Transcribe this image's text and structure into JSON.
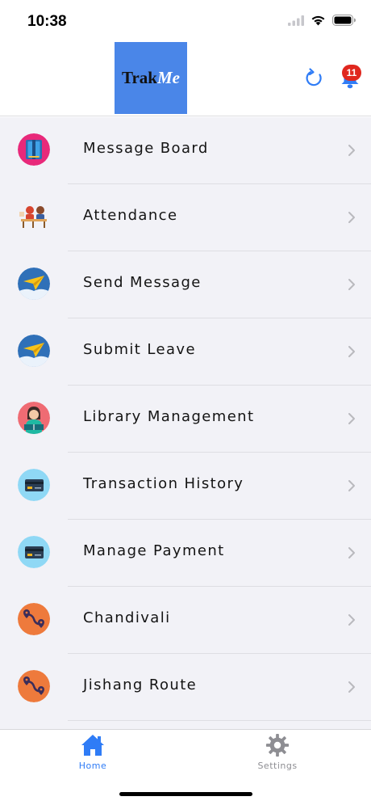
{
  "status_bar": {
    "time": "10:38"
  },
  "header": {
    "logo_part1": "Trak",
    "logo_part2": "Me",
    "notification_count": "11",
    "accent_color": "#2f7cf6",
    "logo_bg_color": "#4a86e8"
  },
  "menu": {
    "items": [
      {
        "label": "Message Board",
        "icon": "book-icon"
      },
      {
        "label": "Attendance",
        "icon": "classroom-icon"
      },
      {
        "label": "Send Message",
        "icon": "paper-plane-icon"
      },
      {
        "label": "Submit Leave",
        "icon": "paper-plane-icon"
      },
      {
        "label": "Library Management",
        "icon": "librarian-icon"
      },
      {
        "label": "Transaction History",
        "icon": "credit-card-icon"
      },
      {
        "label": "Manage Payment",
        "icon": "credit-card-icon"
      },
      {
        "label": "Chandivali",
        "icon": "route-icon"
      },
      {
        "label": "Jishang Route",
        "icon": "route-icon"
      }
    ]
  },
  "tabbar": {
    "home_label": "Home",
    "settings_label": "Settings"
  }
}
